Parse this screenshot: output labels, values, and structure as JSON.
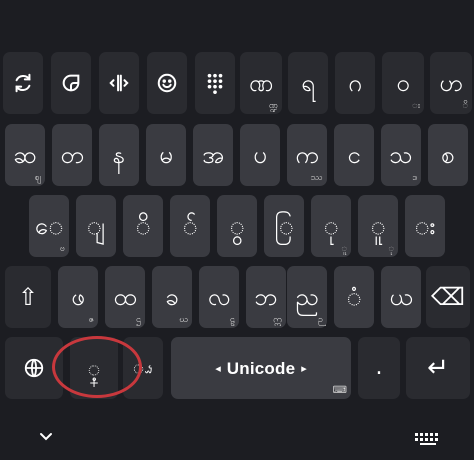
{
  "toolbar": [
    {
      "name": "sync-icon",
      "glyph": "⟲"
    },
    {
      "name": "sticker-icon",
      "glyph": "◔"
    },
    {
      "name": "cursor-move-icon",
      "glyph": "⟷"
    },
    {
      "name": "emoji-icon",
      "glyph": "☺"
    },
    {
      "name": "numpad-icon",
      "glyph": "⠿"
    }
  ],
  "row_tools_keys": [
    {
      "main": "ဏ",
      "sub": "ဏ္ဍ"
    },
    {
      "main": "ရ",
      "sub": ""
    },
    {
      "main": "ဂ",
      "sub": ""
    },
    {
      "main": "ဝ",
      "sub": "း"
    },
    {
      "main": "ဟ",
      "sub": "ိ"
    }
  ],
  "row1": [
    {
      "main": "ဆ",
      "sub": "ဈ"
    },
    {
      "main": "တ",
      "sub": ""
    },
    {
      "main": "န",
      "sub": ""
    },
    {
      "main": "မ",
      "sub": ""
    },
    {
      "main": "အ",
      "sub": ""
    },
    {
      "main": "ပ",
      "sub": ""
    },
    {
      "main": "က",
      "sub": "ဿ"
    },
    {
      "main": "င",
      "sub": ""
    },
    {
      "main": "သ",
      "sub": "ဒ"
    },
    {
      "main": "စ",
      "sub": ""
    }
  ],
  "row2": [
    {
      "main": "ေ",
      "sub": "ဗ"
    },
    {
      "main": "ျ",
      "sub": ""
    },
    {
      "main": "ိ",
      "sub": ""
    },
    {
      "main": "်",
      "sub": ""
    },
    {
      "main": "ွ",
      "sub": ""
    },
    {
      "main": "ြ",
      "sub": ""
    },
    {
      "main": "ု",
      "sub": "ူ"
    },
    {
      "main": "ူ",
      "sub": "ု"
    },
    {
      "main": "း",
      "sub": ""
    }
  ],
  "row3_letters": [
    {
      "main": "ဖ",
      "sub": "ဇ"
    },
    {
      "main": "ထ",
      "sub": "ဌ"
    },
    {
      "main": "ခ",
      "sub": "ဃ"
    },
    {
      "main": "လ",
      "sub": "ဠ"
    },
    {
      "main": "ဘ",
      "sub": "ဣ"
    },
    {
      "main": "ည",
      "sub": "ဉ"
    },
    {
      "main": "ံ",
      "sub": ""
    },
    {
      "main": "ယ",
      "sub": ""
    }
  ],
  "shift_glyph": "⇧",
  "backspace_glyph": "⌫",
  "globe_glyph": "🌐",
  "comma_key": {
    "main": "့",
    "sub": "+"
  },
  "mic_glyph": "ၗ",
  "space": {
    "left_arrow": "◂",
    "label": "Unicode",
    "right_arrow": "▸",
    "sub": "⌨"
  },
  "period": ".",
  "enter_glyph": "↵",
  "nav": {
    "hide_glyph": "⌄",
    "switch_glyph": "⌨"
  },
  "colors": {
    "background": "#1c1d22",
    "key": "#3a3b41",
    "key_dark": "#2a2b30",
    "annotation": "#c8383d"
  }
}
